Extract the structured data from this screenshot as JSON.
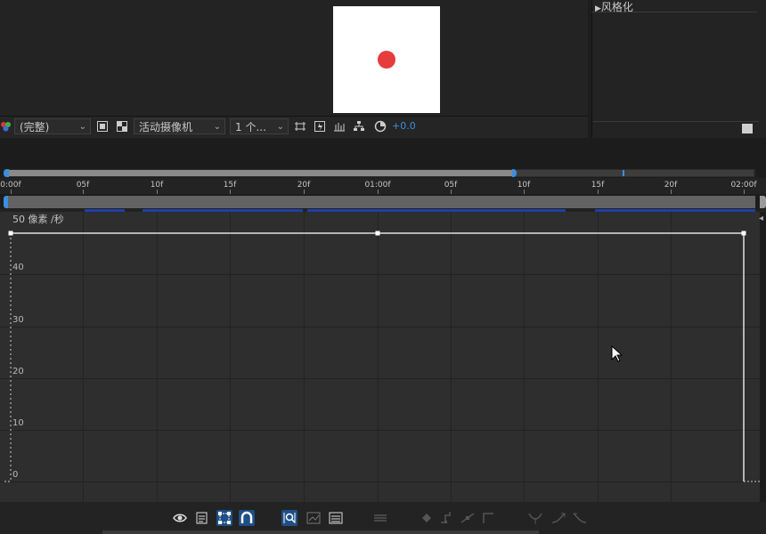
{
  "panel": {
    "section": "风格化"
  },
  "viewer_toolbar": {
    "resolution": "(完整)",
    "camera": "活动摄像机",
    "views": "1 个...",
    "exposure": "+0.0"
  },
  "ruler": {
    "labels": [
      "0:00f",
      "05f",
      "10f",
      "15f",
      "20f",
      "01:00f",
      "05f",
      "10f",
      "15f",
      "20f",
      "02:00f"
    ]
  },
  "graph": {
    "unit_label": "50 像素 /秒",
    "y_labels": [
      "40",
      "30",
      "20",
      "10",
      "0"
    ],
    "speed_value": 50
  },
  "icons": {
    "viewer": [
      "color-channel-icon",
      "toggle-transparency-icon",
      "checkerboard-icon",
      "fast-preview-icon",
      "snapshot-icon",
      "show-channel-icon",
      "flowchart-icon",
      "exposure-reset-icon"
    ],
    "graph": [
      "visibility-eye-icon",
      "graph-type-icon",
      "transform-box-icon",
      "snapping-icon",
      "fit-selection-icon",
      "fit-all-icon",
      "zoom-all-icon",
      "separate-dimensions-icon",
      "edit-keyframe-icon",
      "convert-hold-icon",
      "convert-auto-bezier-icon",
      "easy-ease-icon",
      "easy-ease-in-icon",
      "easy-ease-out-icon"
    ]
  },
  "colors": {
    "accent": "#3b8fe0",
    "layer_dot": "#e63c3c",
    "selected": "#1e4f86"
  }
}
